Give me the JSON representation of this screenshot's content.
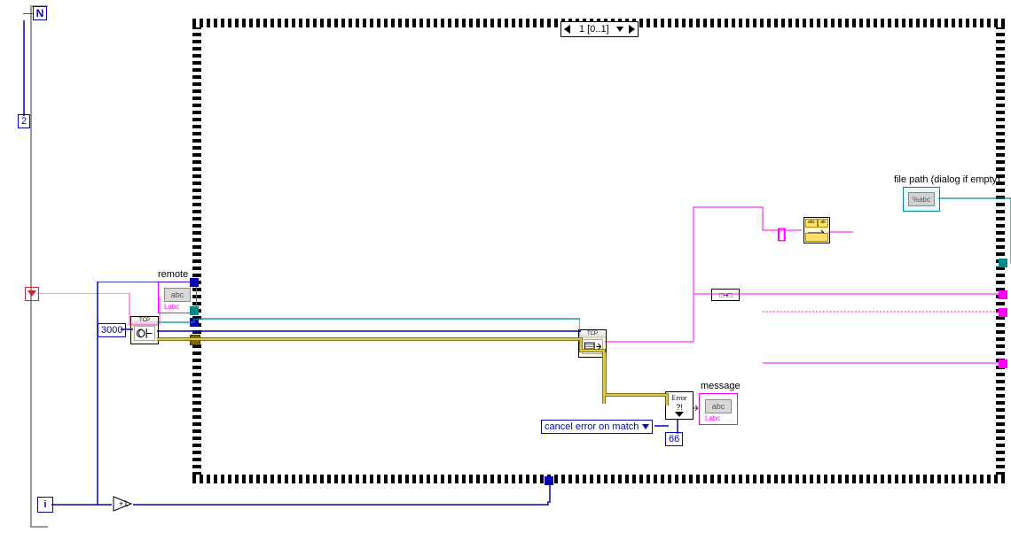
{
  "loop": {
    "n_label": "N",
    "count": "2",
    "i_label": "i"
  },
  "case": {
    "selector": "1 [0..1]"
  },
  "constants": {
    "port": "3000",
    "err_code": "66"
  },
  "ring": {
    "label": "cancel error on match"
  },
  "labels": {
    "remote": "remote",
    "message": "message",
    "filepath": "file path (dialog if empty)",
    "abc": "abc",
    "labc": "Labc",
    "sabc": "%abc",
    "tcp": "TCP",
    "error": "Error",
    "qex": "?!",
    "concat": "□·+□"
  },
  "pink_bracket": "[]"
}
